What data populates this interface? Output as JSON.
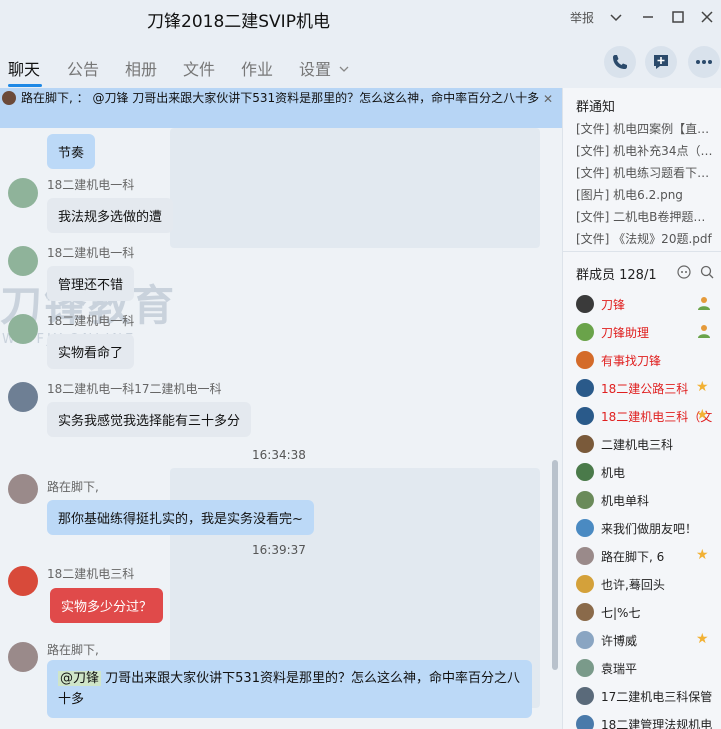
{
  "window": {
    "title": "刀锋2018二建SVIP机电",
    "report": "举报"
  },
  "tabs": [
    "聊天",
    "公告",
    "相册",
    "文件",
    "作业",
    "设置"
  ],
  "pinned": {
    "text": "路在脚下,  ：  @刀锋 刀哥出来跟大家伙讲下531资料是那里的？怎么这么神，命中率百分之八十多"
  },
  "watermark": {
    "main": "刀锋教育",
    "sub": "W.DFJY.ONLINE"
  },
  "messages": [
    {
      "name": "",
      "text": "节奏"
    },
    {
      "name": "18二建机电一科",
      "text": "我法规多选做的遭"
    },
    {
      "name": "18二建机电一科",
      "text": "管理还不错"
    },
    {
      "name": "18二建机电一科",
      "text": "实物看命了"
    },
    {
      "name": "18二建机电一科17二建机电一科",
      "text": "实务我感觉我选择能有三十多分"
    },
    {
      "time": "16:34:38"
    },
    {
      "name": "路在脚下,",
      "text": "那你基础练得挺扎实的，我是实务没看完~"
    },
    {
      "time": "16:39:37"
    },
    {
      "name": "18二建机电三科",
      "text": "实物多少分过？"
    },
    {
      "name": "路在脚下,",
      "mention": "@刀锋",
      "text": " 刀哥出来跟大家伙讲下531资料是那里的？怎么这么神，命中率百分之八十多"
    }
  ],
  "notice": {
    "title": "群通知",
    "items": [
      "[文件] 机电四案例【直…",
      "[文件] 机电补充34点（…",
      "[文件] 机电练习题看下…",
      "[图片] 机电6.2.png",
      "[文件] 二机电B卷押题…",
      "[文件] 《法规》20题.pdf"
    ]
  },
  "members": {
    "title": "群成员 128/1",
    "list": [
      {
        "name": "刀锋",
        "red": true
      },
      {
        "name": "刀锋助理",
        "red": true
      },
      {
        "name": "有事找刀锋",
        "red": true
      },
      {
        "name": "18二建公路三科",
        "red": true
      },
      {
        "name": "18二建机电三科（文",
        "red": true
      },
      {
        "name": "二建机电三科",
        "red": false
      },
      {
        "name": "机电",
        "red": false
      },
      {
        "name": "机电单科",
        "red": false
      },
      {
        "name": "来我们做朋友吧！",
        "red": false
      },
      {
        "name": "路在脚下, 6",
        "red": false
      },
      {
        "name": "也许,蓦回头",
        "red": false
      },
      {
        "name": "七|%七",
        "red": false
      },
      {
        "name": "许博威",
        "red": false
      },
      {
        "name": "袁瑞平",
        "red": false
      },
      {
        "name": "17二建机电三科保管",
        "red": false
      },
      {
        "name": "18二建管理法规机电",
        "red": false
      }
    ]
  },
  "icons": {
    "phone": "phone-icon",
    "add_chat": "add-chat-icon",
    "more": "more-icon"
  }
}
